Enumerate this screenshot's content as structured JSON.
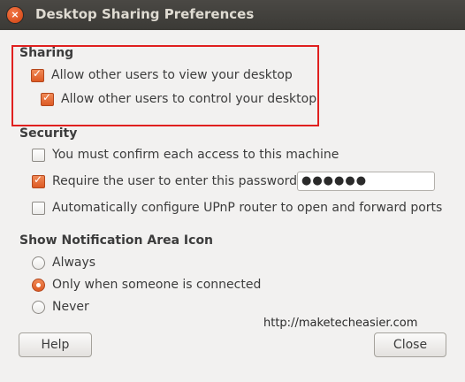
{
  "window": {
    "title": "Desktop Sharing Preferences",
    "close_glyph": "×"
  },
  "sharing": {
    "heading": "Sharing",
    "view_label": "Allow other users to view your desktop",
    "view_checked": true,
    "control_label": "Allow other users to control your desktop",
    "control_checked": true
  },
  "security": {
    "heading": "Security",
    "confirm_label": "You must confirm each access to this machine",
    "confirm_checked": false,
    "password_label": "Require the user to enter this password:",
    "password_checked": true,
    "password_value": "●●●●●●",
    "upnp_label": "Automatically configure UPnP router to open and forward ports",
    "upnp_checked": false
  },
  "notification": {
    "heading": "Show Notification Area Icon",
    "options": [
      "Always",
      "Only when someone is connected",
      "Never"
    ],
    "selected": "Only when someone is connected"
  },
  "watermark": "http://maketecheasier.com",
  "buttons": {
    "help": "Help",
    "close": "Close"
  },
  "colors": {
    "accent": "#dd5a24",
    "highlight_border": "#e0201f",
    "titlebar": "#3b3a36"
  }
}
